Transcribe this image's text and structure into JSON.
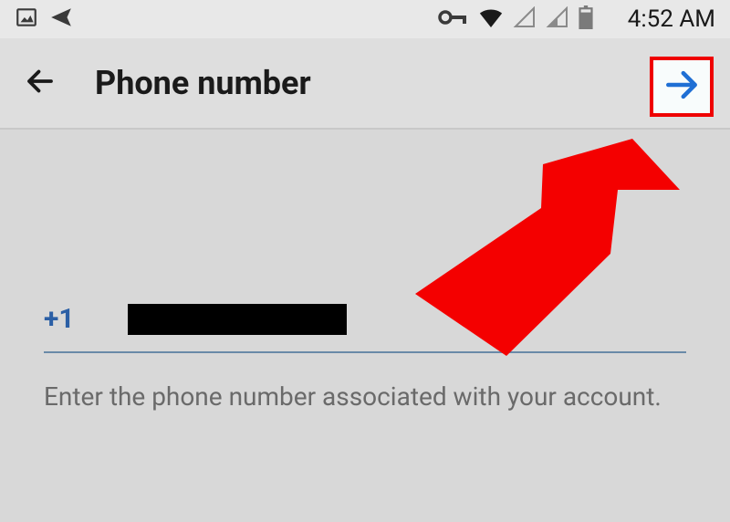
{
  "status_bar": {
    "clock": "4:52 AM"
  },
  "app_bar": {
    "title": "Phone number"
  },
  "form": {
    "country_code": "+1",
    "helper_text": "Enter the phone number associated with your account."
  },
  "annotation": {
    "highlight": "next-button",
    "pointer": "red-arrow"
  }
}
